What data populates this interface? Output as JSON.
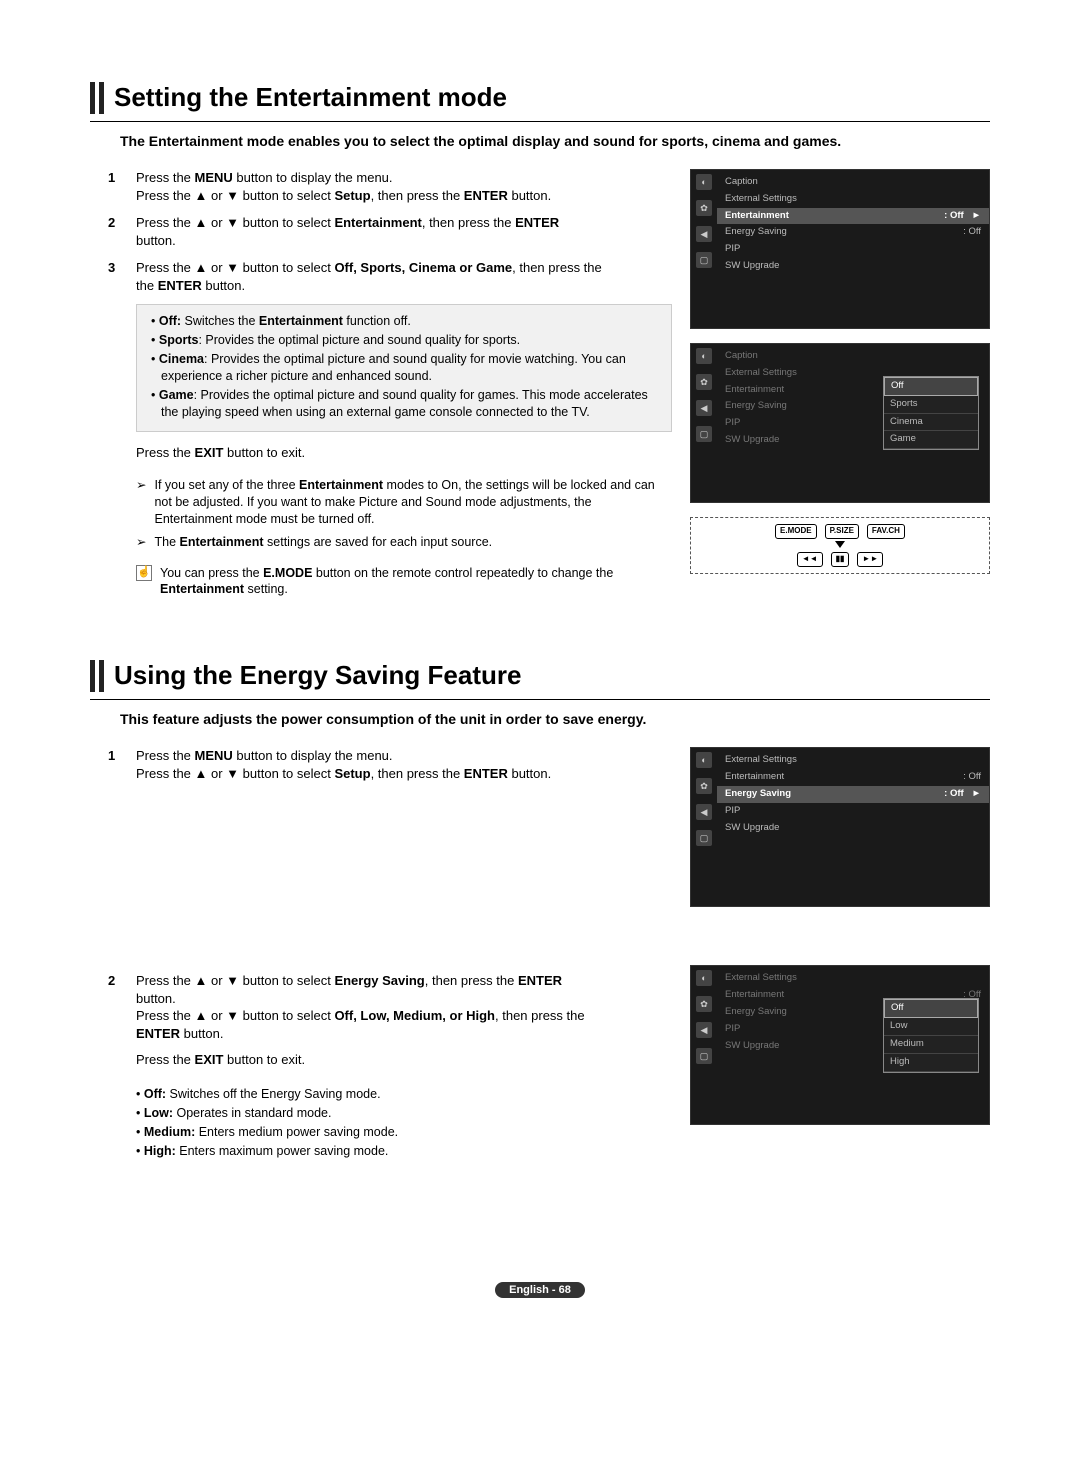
{
  "section1": {
    "title": "Setting the Entertainment mode",
    "intro": "The Entertainment mode enables you to select the optimal display and sound for sports, cinema and games.",
    "step1a": "Press the ",
    "step1b": " button to display the menu.",
    "step1c": "Press the ▲ or ▼ button to select ",
    "step1d": ", then press the ",
    "step1e": " button.",
    "step2a": "Press the ▲ or ▼ button to select ",
    "step2b": ", then press the ",
    "step2c": "button.",
    "step3a": "Press the ▲ or ▼ button to select ",
    "step3b": ", then press the ",
    "step3c": " button.",
    "menuLabel": "MENU",
    "setupLabel": "Setup",
    "enterLabel": "ENTER",
    "entertainmentLabel": "Entertainment",
    "offSportsCinemaGame": "Off, Sports, Cinema or Game",
    "bullets": {
      "off": "Off: Switches the Entertainment function off.",
      "sports": "Sports: Provides the optimal picture and sound quality for sports.",
      "cinema": "Cinema: Provides the optimal picture and sound quality for movie watching. You can experience a richer picture and enhanced sound.",
      "game": "Game: Provides the optimal picture and sound quality for games. This mode accelerates the playing speed when using an external game console connected to the TV."
    },
    "exit": "Press the EXIT button to exit.",
    "note1a": "If you set any of the three ",
    "note1b": " modes to On, the settings will be locked and can not be adjusted. If you want to make Picture and Sound mode adjustments, the Entertainment mode must be turned off.",
    "note2a": "The ",
    "note2b": " settings are saved for each input source.",
    "tip1a": "You can press the ",
    "tip1b": " button on the remote control repeatedly to change the ",
    "tip1c": " setting.",
    "emodeLabel": "E.MODE"
  },
  "section2": {
    "title": "Using the Energy Saving Feature",
    "intro": "This feature adjusts the power consumption of the unit in order to save energy.",
    "step1a": "Press the ",
    "step1b": " button to display the menu.",
    "step1c": "Press the ▲ or ▼ button to select ",
    "step1d": ", then press the ",
    "step1e": " button.",
    "step2a": "Press the ▲ or ▼ button to select ",
    "step2b": ", then press the ",
    "step2c": "button.",
    "step2d": "Press the ▲ or ▼ button to select ",
    "step2e": ", then press the",
    "step2f": " button.",
    "exit": "Press the EXIT button to exit.",
    "energySavingLabel": "Energy Saving",
    "offLowMedHigh": "Off, Low, Medium, or High",
    "bullets": {
      "off": "Off: Switches off the Energy Saving mode.",
      "low": "Low: Operates in standard mode.",
      "medium": "Medium: Enters medium power saving mode.",
      "high": "High: Enters maximum power saving mode."
    }
  },
  "osd": {
    "setupTab": "Setup",
    "menu1": {
      "caption": "Caption",
      "ext": "External Settings",
      "ent": "Entertainment",
      "entVal": ": Off",
      "eng": "Energy Saving",
      "engVal": ": Off",
      "pip": "PIP",
      "sw": "SW Upgrade"
    },
    "dropdown1": {
      "off": "Off",
      "sports": "Sports",
      "cinema": "Cinema",
      "game": "Game"
    },
    "dropdown2": {
      "off": "Off",
      "low": "Low",
      "medium": "Medium",
      "high": "High"
    }
  },
  "remote": {
    "emode": "E.MODE",
    "psize": "P.SIZE",
    "favch": "FAV.CH",
    "rew": "◄◄",
    "pause": "▮▮",
    "ff": "►►"
  },
  "footer": "English - 68"
}
